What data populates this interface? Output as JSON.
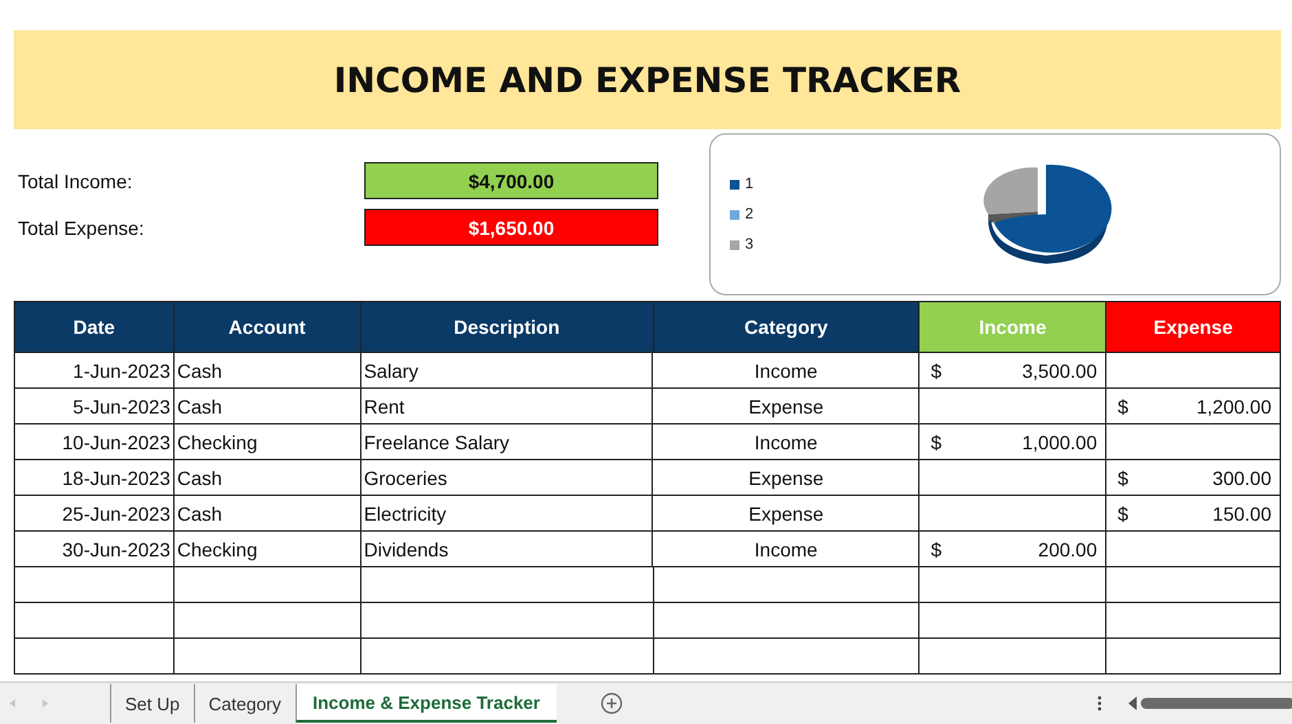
{
  "title": "INCOME AND EXPENSE TRACKER",
  "summary": [
    {
      "label": "Total Income:",
      "value": "$4,700.00",
      "kind": "income"
    },
    {
      "label": "Total Expense:",
      "value": "$1,650.00",
      "kind": "expense"
    }
  ],
  "chart_legend": [
    {
      "label": "1",
      "color": "#0b5394"
    },
    {
      "label": "2",
      "color": "#6fa8dc"
    },
    {
      "label": "3",
      "color": "#a5a5a5"
    }
  ],
  "table": {
    "columns": [
      {
        "label": "Date",
        "kind": "plain"
      },
      {
        "label": "Account",
        "kind": "plain"
      },
      {
        "label": "Description",
        "kind": "plain"
      },
      {
        "label": "Category",
        "kind": "plain"
      },
      {
        "label": "Income",
        "kind": "income"
      },
      {
        "label": "Expense",
        "kind": "expense"
      }
    ],
    "rows": [
      {
        "date": "1-Jun-2023",
        "account": "Cash",
        "description": "Salary",
        "category": "Income",
        "income": {
          "currency": "$",
          "amount": "3,500.00"
        }
      },
      {
        "date": "5-Jun-2023",
        "account": "Cash",
        "description": "Rent",
        "category": "Expense",
        "expense": {
          "currency": "$",
          "amount": "1,200.00"
        }
      },
      {
        "date": "10-Jun-2023",
        "account": "Checking",
        "description": "Freelance Salary",
        "category": "Income",
        "income": {
          "currency": "$",
          "amount": "1,000.00"
        }
      },
      {
        "date": "18-Jun-2023",
        "account": "Cash",
        "description": "Groceries",
        "category": "Expense",
        "expense": {
          "currency": "$",
          "amount": "300.00"
        }
      },
      {
        "date": "25-Jun-2023",
        "account": "Cash",
        "description": "Electricity",
        "category": "Expense",
        "expense": {
          "currency": "$",
          "amount": "150.00"
        }
      },
      {
        "date": "30-Jun-2023",
        "account": "Checking",
        "description": "Dividends",
        "category": "Income",
        "income": {
          "currency": "$",
          "amount": "200.00"
        }
      }
    ]
  },
  "sheet_tabs": [
    {
      "label": "Set Up",
      "selected": false
    },
    {
      "label": "Category",
      "selected": false
    },
    {
      "label": "Income & Expense Tracker",
      "selected": true
    }
  ]
}
